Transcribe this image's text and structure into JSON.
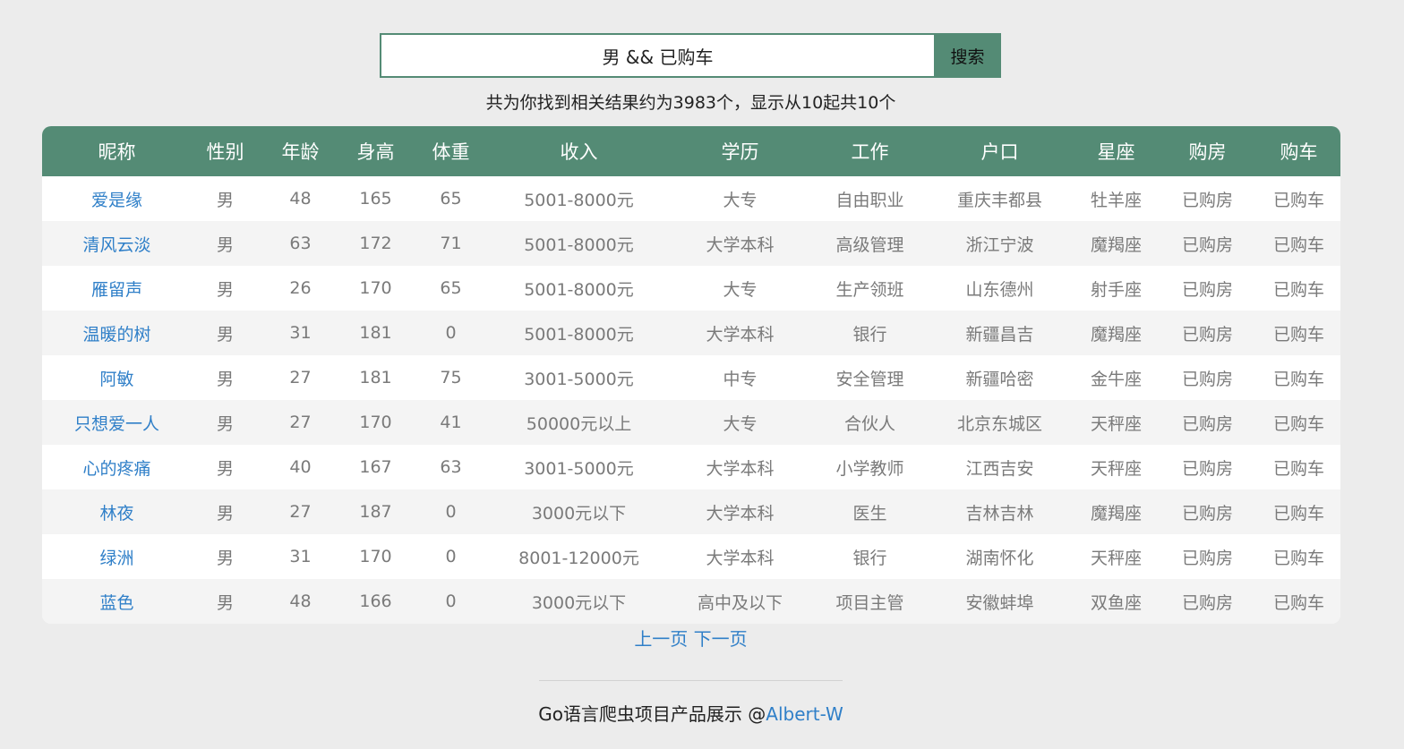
{
  "search": {
    "value": "男 && 已购车",
    "button_label": "搜索"
  },
  "summary": "共为你找到相关结果约为3983个，显示从10起共10个",
  "table": {
    "headers": [
      "昵称",
      "性别",
      "年龄",
      "身高",
      "体重",
      "收入",
      "学历",
      "工作",
      "户口",
      "星座",
      "购房",
      "购车"
    ],
    "rows": [
      [
        "爱是缘",
        "男",
        "48",
        "165",
        "65",
        "5001-8000元",
        "大专",
        "自由职业",
        "重庆丰都县",
        "牡羊座",
        "已购房",
        "已购车"
      ],
      [
        "清风云淡",
        "男",
        "63",
        "172",
        "71",
        "5001-8000元",
        "大学本科",
        "高级管理",
        "浙江宁波",
        "魔羯座",
        "已购房",
        "已购车"
      ],
      [
        "雁留声",
        "男",
        "26",
        "170",
        "65",
        "5001-8000元",
        "大专",
        "生产领班",
        "山东德州",
        "射手座",
        "已购房",
        "已购车"
      ],
      [
        "温暖的树",
        "男",
        "31",
        "181",
        "0",
        "5001-8000元",
        "大学本科",
        "银行",
        "新疆昌吉",
        "魔羯座",
        "已购房",
        "已购车"
      ],
      [
        "阿敏",
        "男",
        "27",
        "181",
        "75",
        "3001-5000元",
        "中专",
        "安全管理",
        "新疆哈密",
        "金牛座",
        "已购房",
        "已购车"
      ],
      [
        "只想爱一人",
        "男",
        "27",
        "170",
        "41",
        "50000元以上",
        "大专",
        "合伙人",
        "北京东城区",
        "天秤座",
        "已购房",
        "已购车"
      ],
      [
        "心的疼痛",
        "男",
        "40",
        "167",
        "63",
        "3001-5000元",
        "大学本科",
        "小学教师",
        "江西吉安",
        "天秤座",
        "已购房",
        "已购车"
      ],
      [
        "林夜",
        "男",
        "27",
        "187",
        "0",
        "3000元以下",
        "大学本科",
        "医生",
        "吉林吉林",
        "魔羯座",
        "已购房",
        "已购车"
      ],
      [
        "绿洲",
        "男",
        "31",
        "170",
        "0",
        "8001-12000元",
        "大学本科",
        "银行",
        "湖南怀化",
        "天秤座",
        "已购房",
        "已购车"
      ],
      [
        "蓝色",
        "男",
        "48",
        "166",
        "0",
        "3000元以下",
        "高中及以下",
        "项目主管",
        "安徽蚌埠",
        "双鱼座",
        "已购房",
        "已购车"
      ]
    ]
  },
  "pager": {
    "prev_label": "上一页",
    "next_label": "下一页"
  },
  "footer": {
    "text": "Go语言爬虫项目产品展示 @",
    "author": "Albert-W"
  },
  "colors": {
    "accent": "#548b75",
    "link": "#2f7fc8",
    "background": "#ececec"
  }
}
